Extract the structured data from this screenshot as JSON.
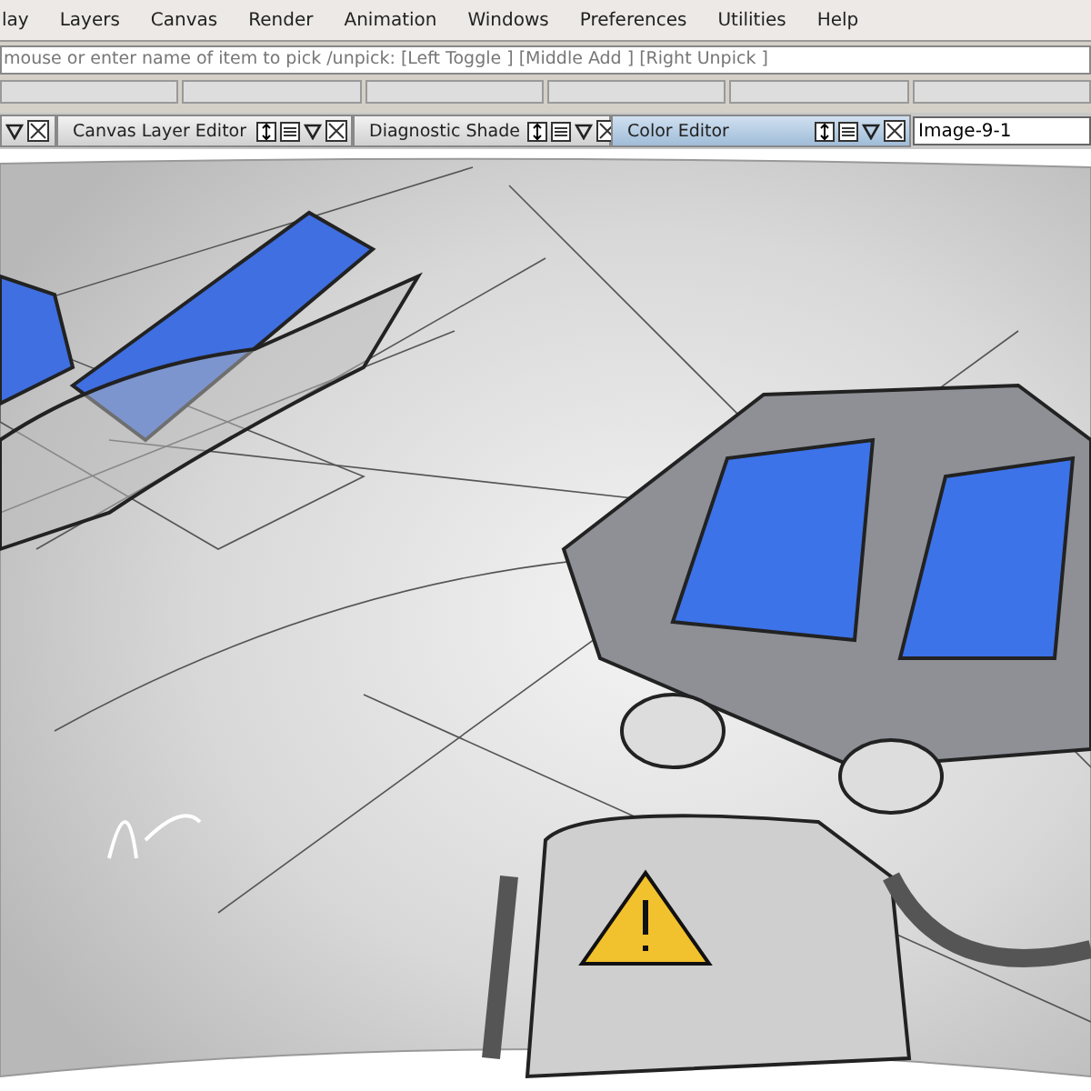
{
  "menu": [
    "lay",
    "Layers",
    "Canvas",
    "Render",
    "Animation",
    "Windows",
    "Preferences",
    "Utilities",
    "Help"
  ],
  "prompt": "mouse or enter name of item to pick /unpick: [Left Toggle ] [Middle Add ] [Right Unpick ]",
  "palette_tabs": [
    {
      "selected": false
    },
    {
      "label": "Canvas Layer Editor",
      "selected": false
    },
    {
      "label": "Diagnostic Shade",
      "selected": false
    },
    {
      "label": "Color Editor",
      "selected": true
    }
  ],
  "image_name": {
    "value": "Image-9-1"
  }
}
